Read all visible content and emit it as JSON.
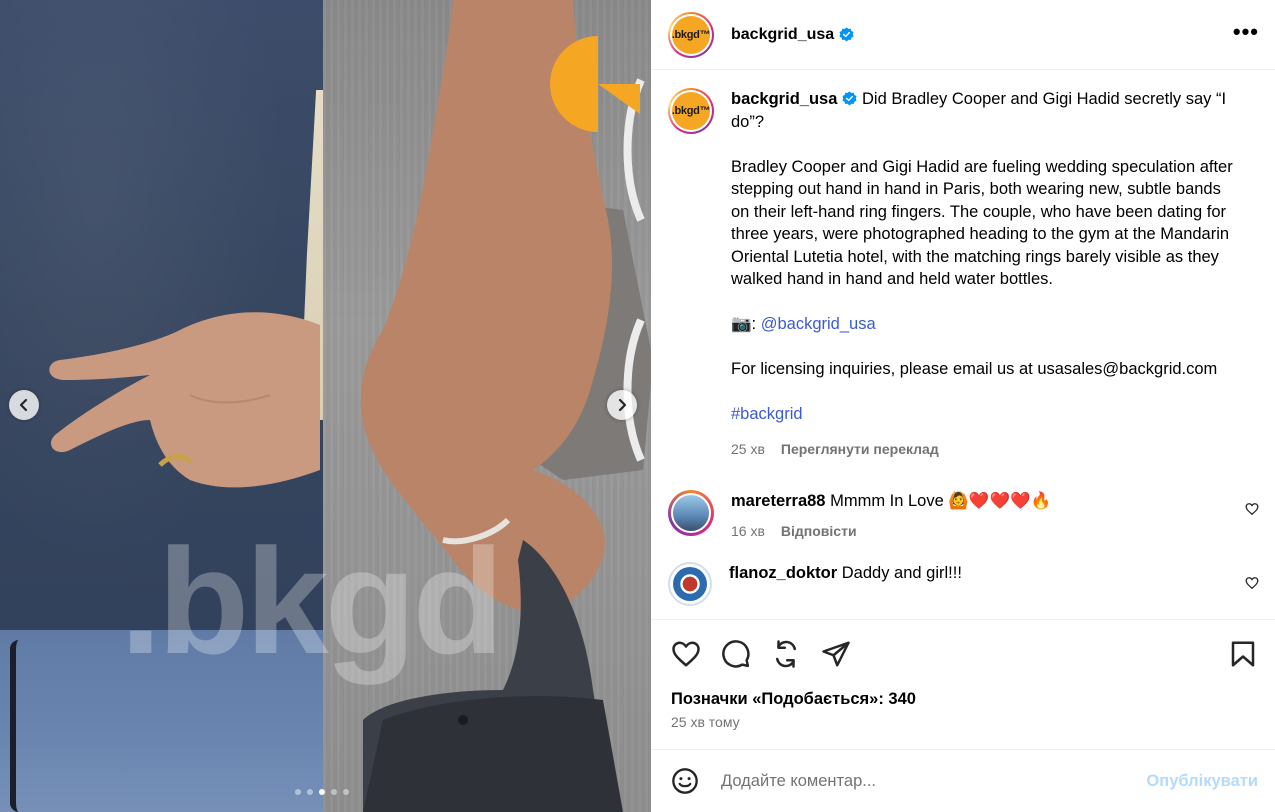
{
  "media": {
    "watermark": ".bkgd",
    "carousel_total": 5,
    "carousel_active": 2
  },
  "header": {
    "avatar_text": ".bkgd™",
    "username": "backgrid_usa",
    "more_label": "•••"
  },
  "caption": {
    "username": "backgrid_usa",
    "headline": "Did Bradley Cooper and Gigi Hadid secretly say “I do”?",
    "body": "Bradley Cooper and Gigi Hadid are fueling wedding speculation after stepping out hand in hand in Paris, both wearing new, subtle bands on their left-hand ring fingers. The couple, who have been dating for three years, were photographed heading to the gym at the Mandarin Oriental Lutetia hotel, with the matching rings barely visible as they walked hand in hand and held water bottles.",
    "camera_prefix": "📷: ",
    "credit_link": "@backgrid_usa",
    "licensing": "For licensing inquiries, please email us at usasales@backgrid.com",
    "hashtag": "#backgrid",
    "time": "25 хв",
    "translate": "Переглянути переклад"
  },
  "comments": [
    {
      "username": "mareterra88",
      "text": "Mmmm In Love 🙆❤️❤️❤️🔥",
      "time": "16 хв",
      "reply": "Відповісти"
    },
    {
      "username": "flanoz_doktor",
      "text": "Daddy and girl!!!"
    }
  ],
  "actions": {
    "likes": "Позначки «Подобається»: 340",
    "time": "25 хв тому"
  },
  "add_comment": {
    "placeholder": "Додайте коментар...",
    "post_label": "Опублікувати"
  },
  "colors": {
    "brand_orange": "#f5a623",
    "link_blue": "#3b5ad6",
    "post_disabled": "#b3dbff",
    "muted": "#737373"
  }
}
